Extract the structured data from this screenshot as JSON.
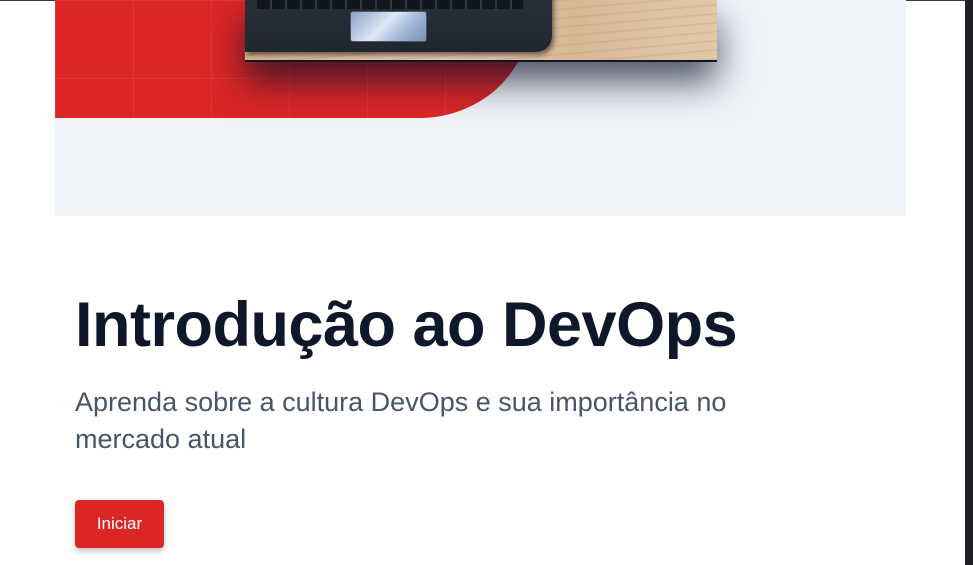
{
  "course": {
    "title": "Introdução ao DevOps",
    "description": "Aprenda sobre a cultura DevOps e sua importância no mercado atual",
    "start_label": "Iniciar"
  },
  "colors": {
    "accent": "#dc2626",
    "title": "#0f172a",
    "text": "#475569",
    "hero_background": "#f0f3f8"
  }
}
